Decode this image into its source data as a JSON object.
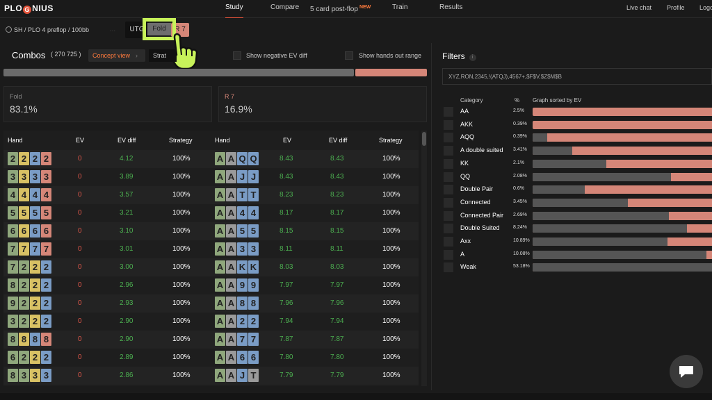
{
  "brand": {
    "name_left": "PLO",
    "name_g": "G",
    "name_right": "NIUS"
  },
  "nav": {
    "study": "Study",
    "compare": "Compare",
    "postflop": "5 card post-flop",
    "postflop_badge": "NEW",
    "train": "Train",
    "results": "Results"
  },
  "right_nav": {
    "live_chat": "Live chat",
    "profile": "Profile",
    "logout": "Logo"
  },
  "breadcrumb": "SH / PLO 4 preflop / 100bb",
  "positions": {
    "dim": "...",
    "utg": "UTG",
    "fold": "Fold",
    "r7": "R 7"
  },
  "combos": {
    "title": "Combos",
    "count": "( 270 725 )",
    "concept_view": "Concept view",
    "strategy": "Strat"
  },
  "options": {
    "neg_ev": "Show negative EV diff",
    "hands_out": "Show hands out range"
  },
  "stats": {
    "fold_label": "Fold",
    "fold_value": "83.1%",
    "fold_fraction": 0.831,
    "r7_label": "R 7",
    "r7_value": "16.9%"
  },
  "table": {
    "headers": {
      "hand": "Hand",
      "ev": "EV",
      "ev_diff": "EV diff",
      "strategy": "Strategy"
    },
    "left_rows": [
      {
        "cards": [
          "2",
          "2",
          "2",
          "2"
        ],
        "colors": [
          "g",
          "y",
          "b",
          "r"
        ],
        "ev": "0",
        "evdiff": "4.12",
        "strategy": "100%"
      },
      {
        "cards": [
          "3",
          "3",
          "3",
          "3"
        ],
        "colors": [
          "g",
          "y",
          "b",
          "r"
        ],
        "ev": "0",
        "evdiff": "3.89",
        "strategy": "100%"
      },
      {
        "cards": [
          "4",
          "4",
          "4",
          "4"
        ],
        "colors": [
          "g",
          "y",
          "b",
          "r"
        ],
        "ev": "0",
        "evdiff": "3.57",
        "strategy": "100%"
      },
      {
        "cards": [
          "5",
          "5",
          "5",
          "5"
        ],
        "colors": [
          "g",
          "y",
          "b",
          "r"
        ],
        "ev": "0",
        "evdiff": "3.21",
        "strategy": "100%"
      },
      {
        "cards": [
          "6",
          "6",
          "6",
          "6"
        ],
        "colors": [
          "g",
          "y",
          "b",
          "r"
        ],
        "ev": "0",
        "evdiff": "3.10",
        "strategy": "100%"
      },
      {
        "cards": [
          "7",
          "7",
          "7",
          "7"
        ],
        "colors": [
          "g",
          "y",
          "b",
          "r"
        ],
        "ev": "0",
        "evdiff": "3.01",
        "strategy": "100%"
      },
      {
        "cards": [
          "7",
          "2",
          "2",
          "2"
        ],
        "colors": [
          "g",
          "g",
          "y",
          "b"
        ],
        "ev": "0",
        "evdiff": "3.00",
        "strategy": "100%"
      },
      {
        "cards": [
          "8",
          "2",
          "2",
          "2"
        ],
        "colors": [
          "g",
          "g",
          "y",
          "b"
        ],
        "ev": "0",
        "evdiff": "2.96",
        "strategy": "100%"
      },
      {
        "cards": [
          "9",
          "2",
          "2",
          "2"
        ],
        "colors": [
          "g",
          "g",
          "y",
          "b"
        ],
        "ev": "0",
        "evdiff": "2.93",
        "strategy": "100%"
      },
      {
        "cards": [
          "3",
          "2",
          "2",
          "2"
        ],
        "colors": [
          "g",
          "g",
          "y",
          "b"
        ],
        "ev": "0",
        "evdiff": "2.90",
        "strategy": "100%"
      },
      {
        "cards": [
          "8",
          "8",
          "8",
          "8"
        ],
        "colors": [
          "g",
          "y",
          "b",
          "r"
        ],
        "ev": "0",
        "evdiff": "2.90",
        "strategy": "100%"
      },
      {
        "cards": [
          "6",
          "2",
          "2",
          "2"
        ],
        "colors": [
          "g",
          "g",
          "y",
          "b"
        ],
        "ev": "0",
        "evdiff": "2.89",
        "strategy": "100%"
      },
      {
        "cards": [
          "8",
          "3",
          "3",
          "3"
        ],
        "colors": [
          "g",
          "g",
          "y",
          "b"
        ],
        "ev": "0",
        "evdiff": "2.86",
        "strategy": "100%"
      }
    ],
    "right_rows": [
      {
        "cards": [
          "A",
          "A",
          "Q",
          "Q"
        ],
        "colors": [
          "g",
          "n",
          "b",
          "b"
        ],
        "ev": "8.43",
        "evdiff": "8.43",
        "strategy": "100%"
      },
      {
        "cards": [
          "A",
          "A",
          "J",
          "J"
        ],
        "colors": [
          "g",
          "n",
          "b",
          "b"
        ],
        "ev": "8.43",
        "evdiff": "8.43",
        "strategy": "100%"
      },
      {
        "cards": [
          "A",
          "A",
          "T",
          "T"
        ],
        "colors": [
          "g",
          "n",
          "b",
          "b"
        ],
        "ev": "8.23",
        "evdiff": "8.23",
        "strategy": "100%"
      },
      {
        "cards": [
          "A",
          "A",
          "4",
          "4"
        ],
        "colors": [
          "g",
          "n",
          "b",
          "b"
        ],
        "ev": "8.17",
        "evdiff": "8.17",
        "strategy": "100%"
      },
      {
        "cards": [
          "A",
          "A",
          "5",
          "5"
        ],
        "colors": [
          "g",
          "n",
          "b",
          "b"
        ],
        "ev": "8.15",
        "evdiff": "8.15",
        "strategy": "100%"
      },
      {
        "cards": [
          "A",
          "A",
          "3",
          "3"
        ],
        "colors": [
          "g",
          "n",
          "b",
          "b"
        ],
        "ev": "8.11",
        "evdiff": "8.11",
        "strategy": "100%"
      },
      {
        "cards": [
          "A",
          "A",
          "K",
          "K"
        ],
        "colors": [
          "g",
          "n",
          "b",
          "b"
        ],
        "ev": "8.03",
        "evdiff": "8.03",
        "strategy": "100%"
      },
      {
        "cards": [
          "A",
          "A",
          "9",
          "9"
        ],
        "colors": [
          "g",
          "n",
          "b",
          "b"
        ],
        "ev": "7.97",
        "evdiff": "7.97",
        "strategy": "100%"
      },
      {
        "cards": [
          "A",
          "A",
          "8",
          "8"
        ],
        "colors": [
          "g",
          "n",
          "b",
          "b"
        ],
        "ev": "7.96",
        "evdiff": "7.96",
        "strategy": "100%"
      },
      {
        "cards": [
          "A",
          "A",
          "2",
          "2"
        ],
        "colors": [
          "g",
          "n",
          "b",
          "b"
        ],
        "ev": "7.94",
        "evdiff": "7.94",
        "strategy": "100%"
      },
      {
        "cards": [
          "A",
          "A",
          "7",
          "7"
        ],
        "colors": [
          "g",
          "n",
          "b",
          "b"
        ],
        "ev": "7.87",
        "evdiff": "7.87",
        "strategy": "100%"
      },
      {
        "cards": [
          "A",
          "A",
          "6",
          "6"
        ],
        "colors": [
          "g",
          "n",
          "b",
          "b"
        ],
        "ev": "7.80",
        "evdiff": "7.80",
        "strategy": "100%"
      },
      {
        "cards": [
          "A",
          "A",
          "J",
          "T"
        ],
        "colors": [
          "g",
          "n",
          "b",
          "n"
        ],
        "ev": "7.79",
        "evdiff": "7.79",
        "strategy": "100%"
      }
    ]
  },
  "filters": {
    "title": "Filters",
    "input_value": "XYZ,RON,2345,!(ATQJ),4567+,$F$V,$Z$M$B",
    "headers": {
      "category": "Category",
      "pct": "%",
      "graph": "Graph sorted by EV"
    },
    "categories": [
      {
        "name": "AA",
        "pct": "2.5%",
        "fold": 0.0
      },
      {
        "name": "AKK",
        "pct": "0.39%",
        "fold": 0.0
      },
      {
        "name": "AQQ",
        "pct": "0.39%",
        "fold": 0.08
      },
      {
        "name": "A double suited",
        "pct": "3.41%",
        "fold": 0.22
      },
      {
        "name": "KK",
        "pct": "2.1%",
        "fold": 0.41
      },
      {
        "name": "QQ",
        "pct": "2.08%",
        "fold": 0.77
      },
      {
        "name": "Double Pair",
        "pct": "0.6%",
        "fold": 0.29
      },
      {
        "name": "Connected",
        "pct": "3.45%",
        "fold": 0.53
      },
      {
        "name": "Connected Pair",
        "pct": "2.69%",
        "fold": 0.76
      },
      {
        "name": "Double Suited",
        "pct": "8.24%",
        "fold": 0.86
      },
      {
        "name": "Axx",
        "pct": "10.89%",
        "fold": 0.75
      },
      {
        "name": "A",
        "pct": "10.08%",
        "fold": 0.97
      },
      {
        "name": "Weak",
        "pct": "53.18%",
        "fold": 1.0
      }
    ]
  },
  "colors": {
    "accent": "#e3533a",
    "raise": "#d58678",
    "fold": "#6b6b6b",
    "highlight": "#c8f35a",
    "ev_positive": "#4caf50",
    "ev_zero": "#e0574a"
  }
}
